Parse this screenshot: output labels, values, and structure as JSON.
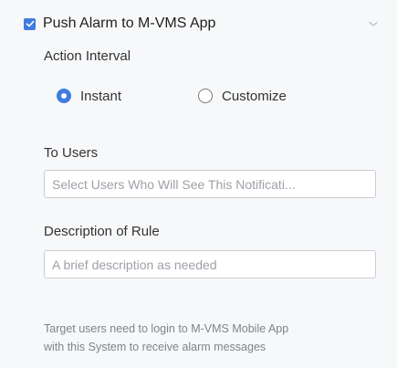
{
  "header": {
    "title": "Push Alarm to M-VMS App",
    "checked": true
  },
  "action_interval": {
    "label": "Action Interval",
    "options": [
      {
        "label": "Instant",
        "selected": true
      },
      {
        "label": "Customize",
        "selected": false
      }
    ]
  },
  "to_users": {
    "label": "To Users",
    "placeholder": "Select Users Who Will See This Notificati..."
  },
  "description": {
    "label": "Description of Rule",
    "placeholder": "A brief description as needed"
  },
  "hint": {
    "line1": "Target users need to login to M-VMS Mobile App",
    "line2": "with this System to receive alarm messages"
  },
  "colors": {
    "accent": "#3f7be0",
    "panel_bg": "#f7f8fa",
    "hint_text": "#7f838a"
  },
  "icons": {
    "checkbox": "checkbox-checked-icon",
    "collapse": "chevron-down-icon"
  }
}
